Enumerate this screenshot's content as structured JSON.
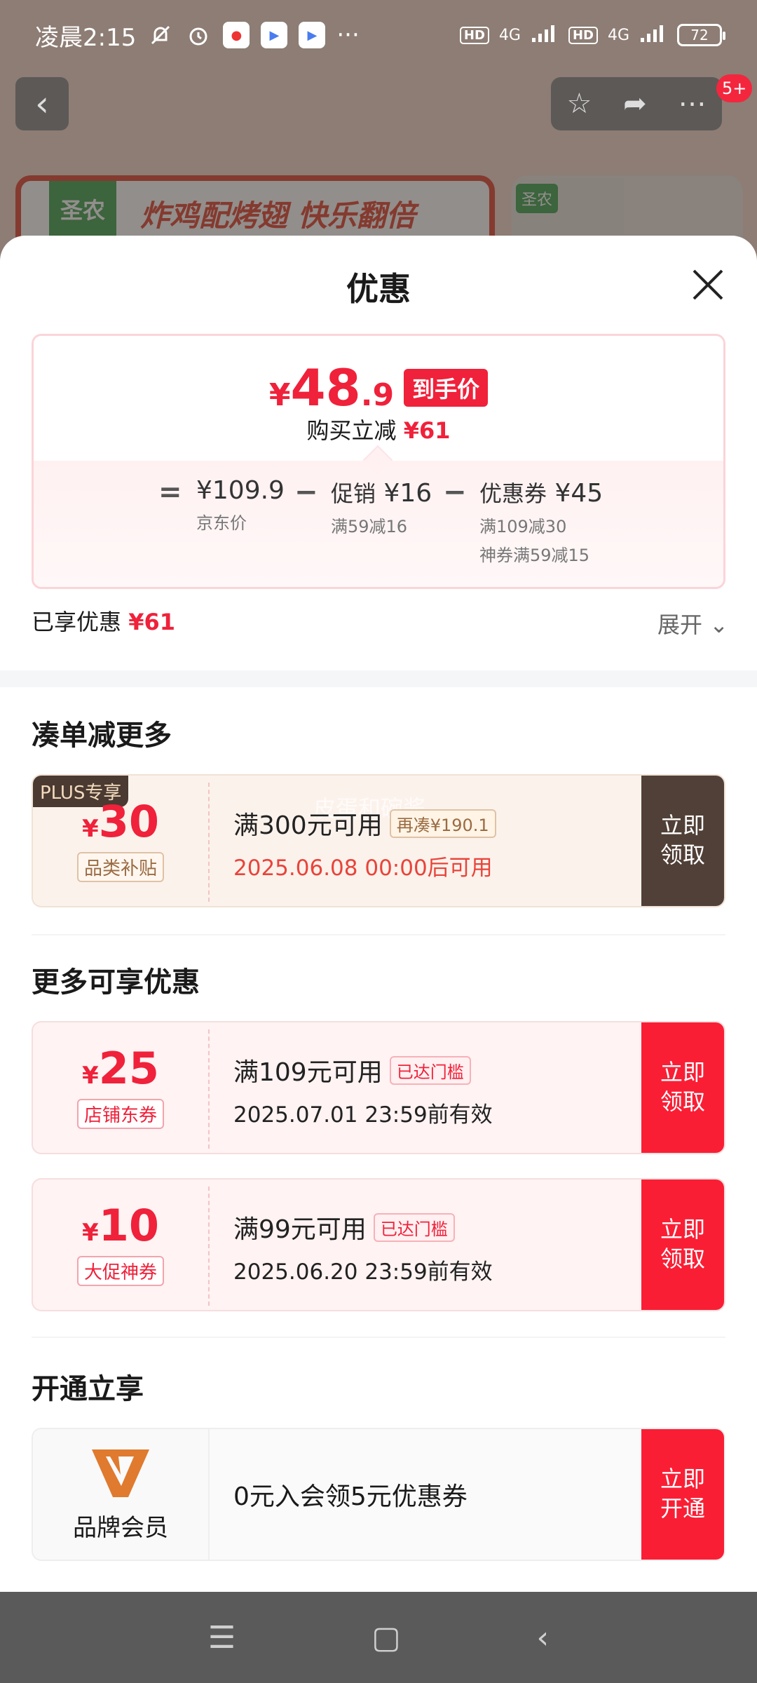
{
  "status_bar": {
    "time": "凌晨2:15",
    "dots": "···",
    "network1": "4G",
    "network2": "4G",
    "hd1": "HD",
    "hd2": "HD",
    "battery": "72"
  },
  "background": {
    "notification_count": "5+",
    "banner_brand": "圣农",
    "banner_slogan": "炸鸡配烤翅 快乐翻倍",
    "banner2_brand": "圣农"
  },
  "sheet": {
    "title": "优惠",
    "price": {
      "yen": "¥",
      "int": "48",
      "dec": ".9",
      "tag": "到手价",
      "reduce_label": "购买立减",
      "reduce_value": "¥61"
    },
    "calc": {
      "eq": "=",
      "jd_price": "¥109.9",
      "jd_label": "京东价",
      "minus1": "−",
      "promo_label": "促销",
      "promo_value": "¥16",
      "promo_rule": "满59减16",
      "minus2": "−",
      "coupon_label": "优惠券",
      "coupon_value": "¥45",
      "coupon_rule1": "满109减30",
      "coupon_rule2": "神券满59减15"
    },
    "enjoyed_label": "已享优惠",
    "enjoyed_value": "¥61",
    "expand_label": "展开"
  },
  "sections": {
    "more_reduce_title": "凑单减更多",
    "more_offers_title": "更多可享优惠",
    "open_title": "开通立享"
  },
  "coupons": [
    {
      "badge": "PLUS专享",
      "yen": "¥",
      "amount": "30",
      "tag": "品类补贴",
      "condition": "满300元可用",
      "pill": "再凑¥190.1",
      "date": "2025.06.08 00:00后可用",
      "button": "立即领取",
      "watermark": "皮蛋和碗酱"
    },
    {
      "yen": "¥",
      "amount": "25",
      "tag": "店铺东券",
      "condition": "满109元可用",
      "pill": "已达门槛",
      "date": "2025.07.01 23:59前有效",
      "button": "立即领取"
    },
    {
      "yen": "¥",
      "amount": "10",
      "tag": "大促神券",
      "condition": "满99元可用",
      "pill": "已达门槛",
      "date": "2025.06.20 23:59前有效",
      "button": "立即领取"
    }
  ],
  "member": {
    "label": "品牌会员",
    "text": "0元入会领5元优惠券",
    "button": "立即开通"
  },
  "colors": {
    "accent_red": "#fa1e35",
    "plus_brown": "#514037",
    "member_orange": "#e07a2e"
  }
}
